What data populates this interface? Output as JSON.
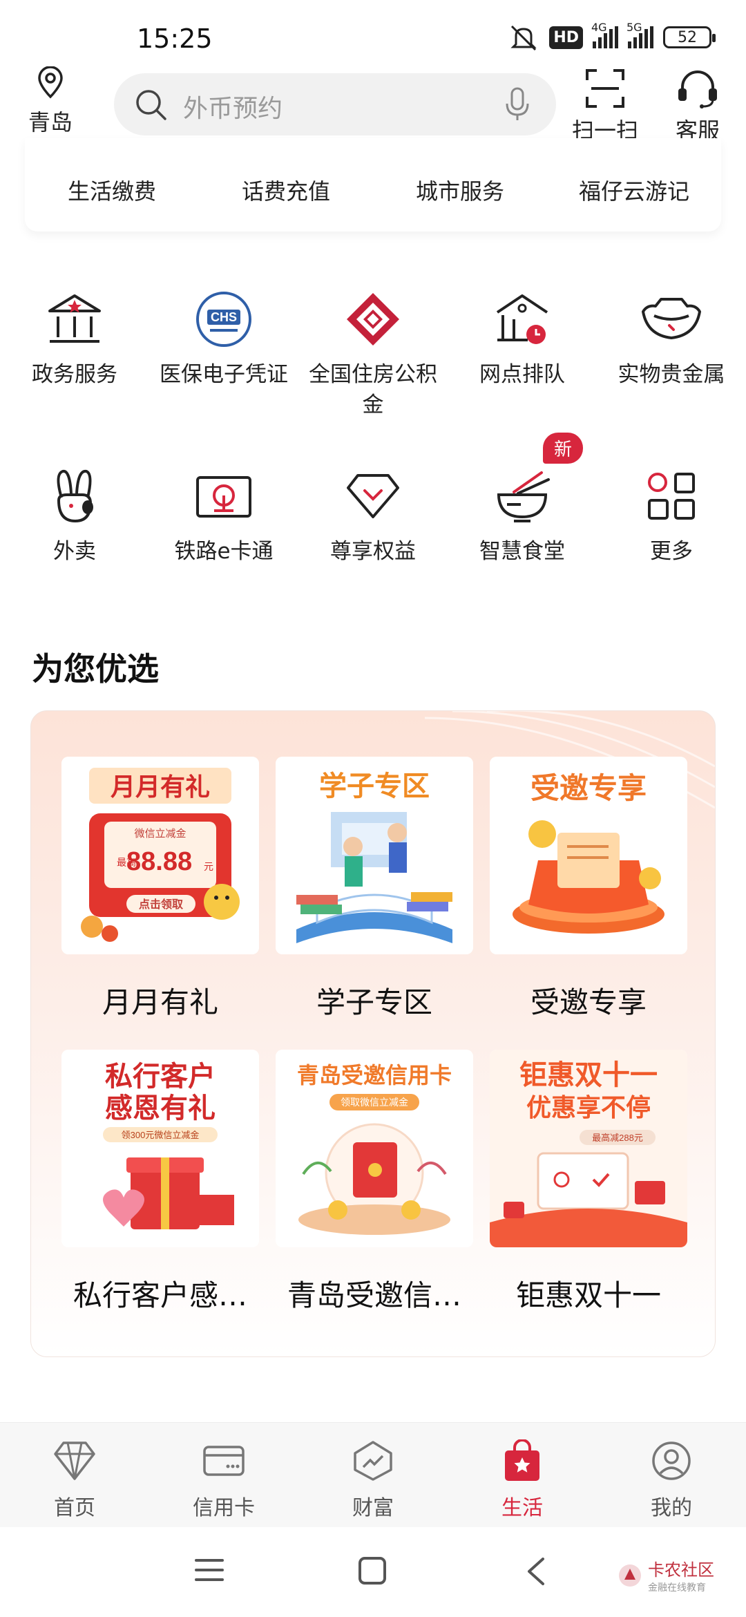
{
  "status_bar": {
    "time": "15:25",
    "hd": "HD",
    "net1": "4G",
    "net2": "5G",
    "battery": "52"
  },
  "header": {
    "location": "青岛",
    "search_placeholder": "外币预约",
    "scan_label": "扫一扫",
    "service_label": "客服"
  },
  "top_services": [
    {
      "label": "生活缴费",
      "icon": "bill-icon"
    },
    {
      "label": "话费充值",
      "icon": "phone-topup-icon"
    },
    {
      "label": "城市服务",
      "icon": "city-icon"
    },
    {
      "label": "福仔云游记",
      "icon": "travel-icon"
    }
  ],
  "grid_row1": [
    {
      "label": "政务服务",
      "icon": "government-icon"
    },
    {
      "label": "医保电子凭证",
      "icon": "chs-medical-icon"
    },
    {
      "label": "全国住房公积金",
      "icon": "housing-fund-icon"
    },
    {
      "label": "网点排队",
      "icon": "branch-queue-icon"
    },
    {
      "label": "实物贵金属",
      "icon": "gold-ingot-icon"
    }
  ],
  "grid_row2": [
    {
      "label": "外卖",
      "icon": "rabbit-icon"
    },
    {
      "label": "铁路e卡通",
      "icon": "railway-card-icon"
    },
    {
      "label": "尊享权益",
      "icon": "diamond-icon"
    },
    {
      "label": "智慧食堂",
      "icon": "bowl-icon",
      "badge": "新"
    },
    {
      "label": "更多",
      "icon": "grid-more-icon"
    }
  ],
  "chs_logo_text": "CHS",
  "section_title": "为您优选",
  "promos": [
    {
      "caption": "月月有礼",
      "banner": "月月有礼",
      "sub": "微信立减金",
      "amount": "88.88",
      "max_label": "最高",
      "unit": "元",
      "cta": "点击领取"
    },
    {
      "caption": "学子专区",
      "banner": "学子专区"
    },
    {
      "caption": "受邀专享",
      "banner": "受邀专享"
    },
    {
      "caption": "私行客户感…",
      "banner": "私行客户",
      "banner2": "感恩有礼",
      "sub": "领300元微信立减金"
    },
    {
      "caption": "青岛受邀信…",
      "banner": "青岛受邀信用卡",
      "sub": "领取微信立减金"
    },
    {
      "caption": "钜惠双十一",
      "banner": "钜惠双十一",
      "banner2": "优惠享不停",
      "sub": "最高减288元"
    }
  ],
  "bottom_nav": [
    {
      "label": "首页",
      "icon": "diamond-home-icon",
      "active": false
    },
    {
      "label": "信用卡",
      "icon": "credit-card-icon",
      "active": false
    },
    {
      "label": "财富",
      "icon": "wealth-icon",
      "active": false
    },
    {
      "label": "生活",
      "icon": "shopping-bag-icon",
      "active": true
    },
    {
      "label": "我的",
      "icon": "profile-icon",
      "active": false
    }
  ],
  "watermark": {
    "title": "卡农社区",
    "subtitle": "金融在线教育"
  },
  "colors": {
    "accent": "#d7263d",
    "text": "#222222",
    "muted": "#999999"
  }
}
